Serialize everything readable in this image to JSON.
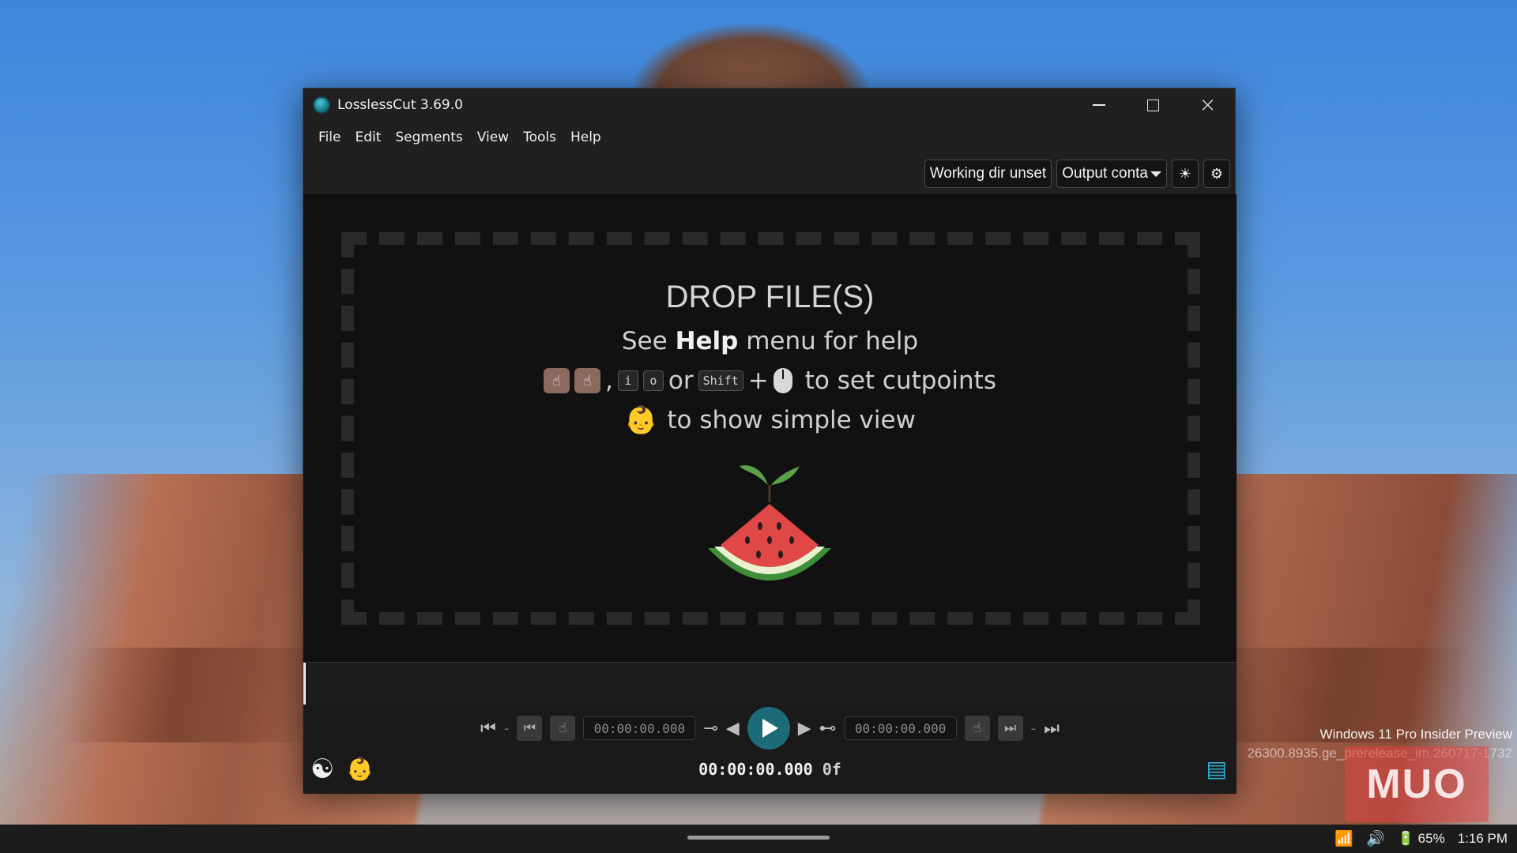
{
  "window": {
    "title": "LosslessCut 3.69.0"
  },
  "menu": [
    "File",
    "Edit",
    "Segments",
    "View",
    "Tools",
    "Help"
  ],
  "toolbar": {
    "working_dir": "Working dir unset",
    "output_container": "Output conta"
  },
  "drop": {
    "title": "DROP FILE(S)",
    "help_prefix": "See ",
    "help_bold": "Help",
    "help_suffix": " menu for help",
    "key_i": "i",
    "key_o": "o",
    "or": "or",
    "shift": "Shift",
    "plus": "+",
    "cutpoints_text": "to set cutpoints",
    "simple_view_text": "to show simple view",
    "comma": ","
  },
  "controls": {
    "start_time": "00:00:00.000",
    "end_time": "00:00:00.000",
    "dash": "-",
    "current_time": "00:00:00.000",
    "current_frames": "0f"
  },
  "watermark": {
    "line1": "Windows 11 Pro Insider Preview",
    "line2": "26300.8935.ge_prerelease_im.260717-1732",
    "logo": "MUO"
  },
  "taskbar": {
    "battery": "65%",
    "time": "1:16 PM"
  },
  "colors": {
    "accent": "#1b6b78",
    "segments": "#2ab3d6",
    "background": "#111111"
  }
}
